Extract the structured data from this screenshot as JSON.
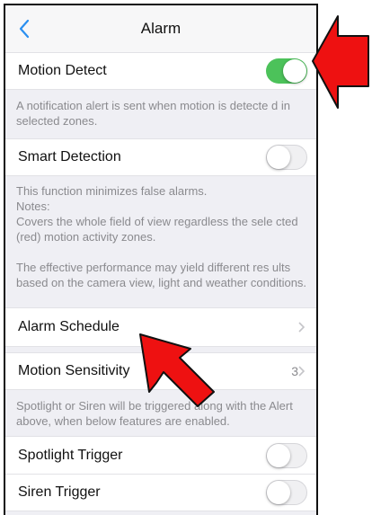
{
  "nav": {
    "title": "Alarm",
    "back_icon": "chevron-left-icon"
  },
  "motion_detect": {
    "label": "Motion Detect",
    "enabled": true
  },
  "motion_note": "A notification alert is sent when motion is detecte d in selected zones.",
  "smart_detection": {
    "label": "Smart Detection",
    "enabled": false
  },
  "smart_note": {
    "line1": "This function minimizes false alarms.",
    "line2": "Notes:",
    "line3": "Covers the whole field of view regardless the sele cted (red) motion activity zones.",
    "line4": "The effective performance may yield different res ults based on the camera view, light and weather conditions."
  },
  "alarm_schedule": {
    "label": "Alarm Schedule"
  },
  "motion_sensitivity": {
    "label": "Motion Sensitivity",
    "value": "3"
  },
  "sensitivity_note": "Spotlight or Siren will be triggered along with the Alert above, when below features are enabled.",
  "spotlight_trigger": {
    "label": "Spotlight Trigger",
    "enabled": false
  },
  "siren_trigger": {
    "label": "Siren Trigger",
    "enabled": false
  },
  "colors": {
    "toggle_on": "#4cc25a",
    "accent": "#2a8ff0",
    "annotation_arrow": "#ee1111"
  }
}
